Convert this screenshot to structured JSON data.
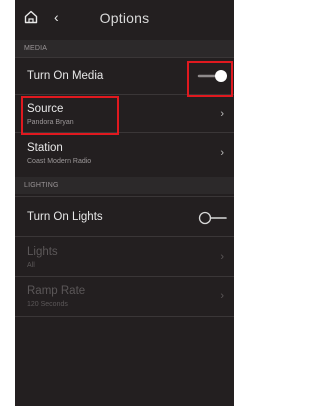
{
  "header": {
    "title": "Options",
    "back_glyph": "‹"
  },
  "sections": {
    "media": {
      "label": "MEDIA",
      "turn_on_media": {
        "label": "Turn On Media",
        "toggle": "on"
      },
      "source": {
        "label": "Source",
        "value": "Pandora Bryan"
      },
      "station": {
        "label": "Station",
        "value": "Coast Modern Radio"
      }
    },
    "lighting": {
      "label": "LIGHTING",
      "turn_on_lights": {
        "label": "Turn On Lights",
        "toggle": "off"
      },
      "lights": {
        "label": "Lights",
        "value": "All"
      },
      "ramp_rate": {
        "label": "Ramp Rate",
        "value": "120 Seconds"
      }
    }
  },
  "chevron": "›",
  "colors": {
    "background": "#231f20",
    "section_band": "#2c292a",
    "highlight": "#e0191f",
    "text": "#e8e8e8",
    "subtext": "#9c9899",
    "disabled": "#5b5758"
  },
  "icons": [
    "home-icon",
    "back-icon",
    "chevron-right-icon",
    "toggle-on-icon",
    "toggle-off-icon"
  ]
}
